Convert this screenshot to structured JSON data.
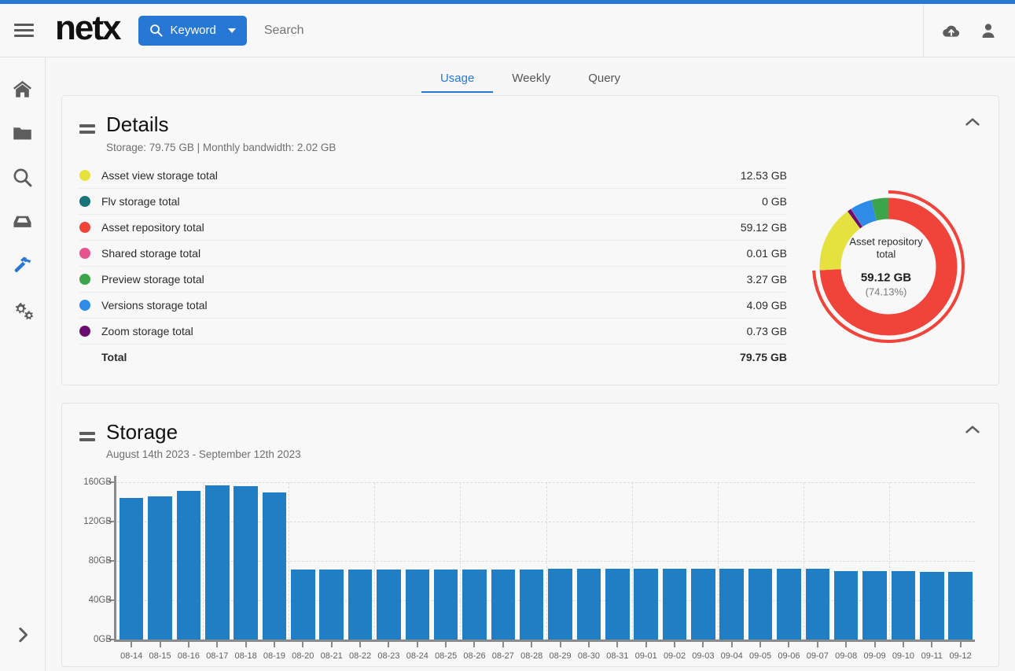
{
  "header": {
    "logo": "netx",
    "keyword_button": "Keyword",
    "search_placeholder": "Search",
    "search_value": "",
    "icons": {
      "menu": "hamburger-icon",
      "upload": "cloud-upload-icon",
      "user": "user-icon"
    }
  },
  "sidebar": {
    "items": [
      {
        "name": "home",
        "icon": "home-icon",
        "active": false
      },
      {
        "name": "folders",
        "icon": "folder-icon",
        "active": false
      },
      {
        "name": "search",
        "icon": "search-icon",
        "active": false
      },
      {
        "name": "inbox",
        "icon": "inbox-icon",
        "active": false
      },
      {
        "name": "tools",
        "icon": "hammer-icon",
        "active": true
      },
      {
        "name": "settings",
        "icon": "gears-icon",
        "active": false
      }
    ],
    "expand": "chevron-right-icon",
    "active_color": "#2778d4"
  },
  "tabs": [
    {
      "label": "Usage",
      "active": true
    },
    {
      "label": "Weekly",
      "active": false
    },
    {
      "label": "Query",
      "active": false
    }
  ],
  "details": {
    "title": "Details",
    "subtitle": "Storage: 79.75 GB | Monthly bandwidth: 2.02 GB",
    "collapse_icon": "chevron-up-icon",
    "drag_icon": "drag-handle-icon",
    "rows": [
      {
        "label": "Asset view storage total",
        "value": "12.53 GB",
        "color": "#e5e23f"
      },
      {
        "label": "Flv storage total",
        "value": "0 GB",
        "color": "#17757a"
      },
      {
        "label": "Asset repository total",
        "value": "59.12 GB",
        "color": "#f0433a"
      },
      {
        "label": "Shared storage total",
        "value": "0.01 GB",
        "color": "#e8538f"
      },
      {
        "label": "Preview storage total",
        "value": "3.27 GB",
        "color": "#3ca54c"
      },
      {
        "label": "Versions storage total",
        "value": "4.09 GB",
        "color": "#2e8ce8"
      },
      {
        "label": "Zoom storage total",
        "value": "0.73 GB",
        "color": "#6a0d6e"
      }
    ],
    "total_label": "Total",
    "total_value": "79.75 GB",
    "donut": {
      "center_title": "Asset repository\ntotal",
      "center_title_line1": "Asset repository",
      "center_title_line2": "total",
      "center_value": "59.12 GB",
      "center_percent": "(74.13%)",
      "highlighted_slice": "Asset repository total"
    }
  },
  "storage": {
    "title": "Storage",
    "subtitle": "August 14th 2023 - September 12th 2023",
    "collapse_icon": "chevron-up-icon",
    "drag_icon": "drag-handle-icon"
  },
  "chart_data": [
    {
      "type": "pie",
      "title": "Storage breakdown",
      "unit": "GB",
      "labels": [
        "Asset view storage total",
        "Flv storage total",
        "Asset repository total",
        "Shared storage total",
        "Preview storage total",
        "Versions storage total",
        "Zoom storage total"
      ],
      "values": [
        12.53,
        0,
        59.12,
        0.01,
        3.27,
        4.09,
        0.73
      ],
      "colors": [
        "#e5e23f",
        "#17757a",
        "#f0433a",
        "#e8538f",
        "#3ca54c",
        "#2e8ce8",
        "#6a0d6e"
      ],
      "total": 79.75,
      "highlight_index": 2,
      "highlight_percent": 74.13,
      "legend": "left-table",
      "donut": true
    },
    {
      "type": "bar",
      "title": "Storage",
      "subtitle": "August 14th 2023 - September 12th 2023",
      "xlabel": "",
      "ylabel": "",
      "ylim": [
        0,
        160
      ],
      "ytick_labels": [
        "0GB",
        "40GB",
        "80GB",
        "120GB",
        "160GB"
      ],
      "ytick_values": [
        0,
        40,
        80,
        120,
        160
      ],
      "grid": true,
      "bar_color": "#1f7ec4",
      "categories": [
        "08-14",
        "08-15",
        "08-16",
        "08-17",
        "08-18",
        "08-19",
        "08-20",
        "08-21",
        "08-22",
        "08-23",
        "08-24",
        "08-25",
        "08-26",
        "08-27",
        "08-28",
        "08-29",
        "08-30",
        "08-31",
        "09-01",
        "09-02",
        "09-03",
        "09-04",
        "09-05",
        "09-06",
        "09-07",
        "09-08",
        "09-09",
        "09-10",
        "09-11",
        "09-12"
      ],
      "values": [
        144,
        146,
        151,
        157,
        156,
        150,
        71.5,
        71.5,
        71.5,
        71.5,
        71.5,
        71.5,
        71.5,
        71.5,
        71.5,
        72,
        72,
        72,
        72,
        72,
        72,
        72,
        72,
        72,
        72,
        70,
        70,
        70,
        69,
        69
      ]
    }
  ]
}
